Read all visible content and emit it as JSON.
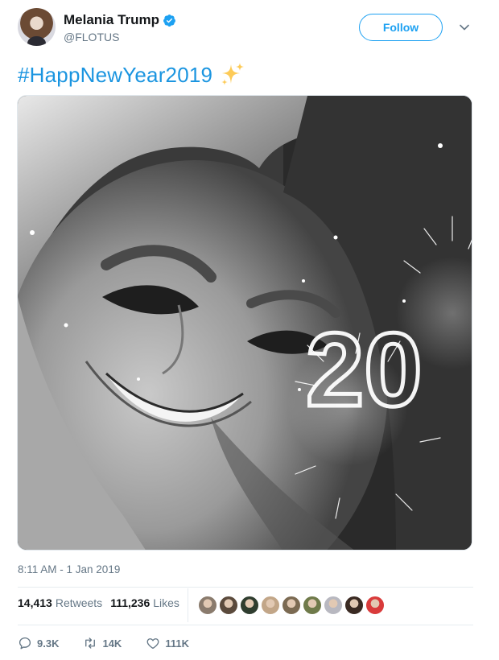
{
  "user": {
    "display_name": "Melania Trump",
    "handle": "@FLOTUS",
    "verified_icon": "verified-badge-icon",
    "accent_color": "#1da1f2"
  },
  "header": {
    "follow_label": "Follow"
  },
  "tweet": {
    "text": "#HappNewYear2019",
    "emoji_icon": "sparkles-icon",
    "media_overlay_text": "20",
    "timestamp": "8:11 AM - 1 Jan 2019"
  },
  "stats": {
    "retweets_count": "14,413",
    "retweets_label": "Retweets",
    "likes_count": "111,236",
    "likes_label": "Likes",
    "liker_avatars": [
      "#8a7b6d",
      "#5b4a3c",
      "#2f3d2f",
      "#c2a688",
      "#7b6a52",
      "#6f7a4a",
      "#b8b8c0",
      "#3a2a22",
      "#d93b3b"
    ]
  },
  "actions": {
    "replies": "9.3K",
    "retweets": "14K",
    "likes": "111K"
  }
}
